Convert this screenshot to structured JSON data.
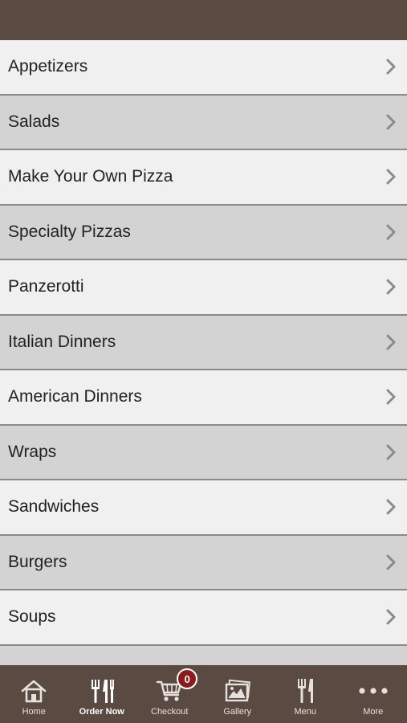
{
  "colors": {
    "header_bg": "#5b4a42",
    "row_light": "#f0f0f0",
    "row_dark": "#d3d3d3",
    "badge_bg": "#8b1a1a"
  },
  "menu": {
    "items": [
      {
        "label": "Appetizers",
        "icon": "chevron-right-icon"
      },
      {
        "label": "Salads",
        "icon": "chevron-right-icon"
      },
      {
        "label": "Make Your Own Pizza",
        "icon": "chevron-right-icon"
      },
      {
        "label": "Specialty Pizzas",
        "icon": "chevron-right-icon"
      },
      {
        "label": "Panzerotti",
        "icon": "chevron-right-icon"
      },
      {
        "label": "Italian Dinners",
        "icon": "chevron-right-icon"
      },
      {
        "label": "American Dinners",
        "icon": "chevron-right-icon"
      },
      {
        "label": "Wraps",
        "icon": "chevron-right-icon"
      },
      {
        "label": "Sandwiches",
        "icon": "chevron-right-icon"
      },
      {
        "label": "Burgers",
        "icon": "chevron-right-icon"
      },
      {
        "label": "Soups",
        "icon": "chevron-right-icon"
      }
    ]
  },
  "tabbar": {
    "tabs": [
      {
        "label": "Home",
        "icon": "home-icon"
      },
      {
        "label": "Order Now",
        "icon": "utensils-icon",
        "active": true
      },
      {
        "label": "Checkout",
        "icon": "cart-icon",
        "badge": "0"
      },
      {
        "label": "Gallery",
        "icon": "gallery-icon"
      },
      {
        "label": "Menu",
        "icon": "fork-knife-icon"
      },
      {
        "label": "More",
        "icon": "more-dots-icon"
      }
    ]
  }
}
